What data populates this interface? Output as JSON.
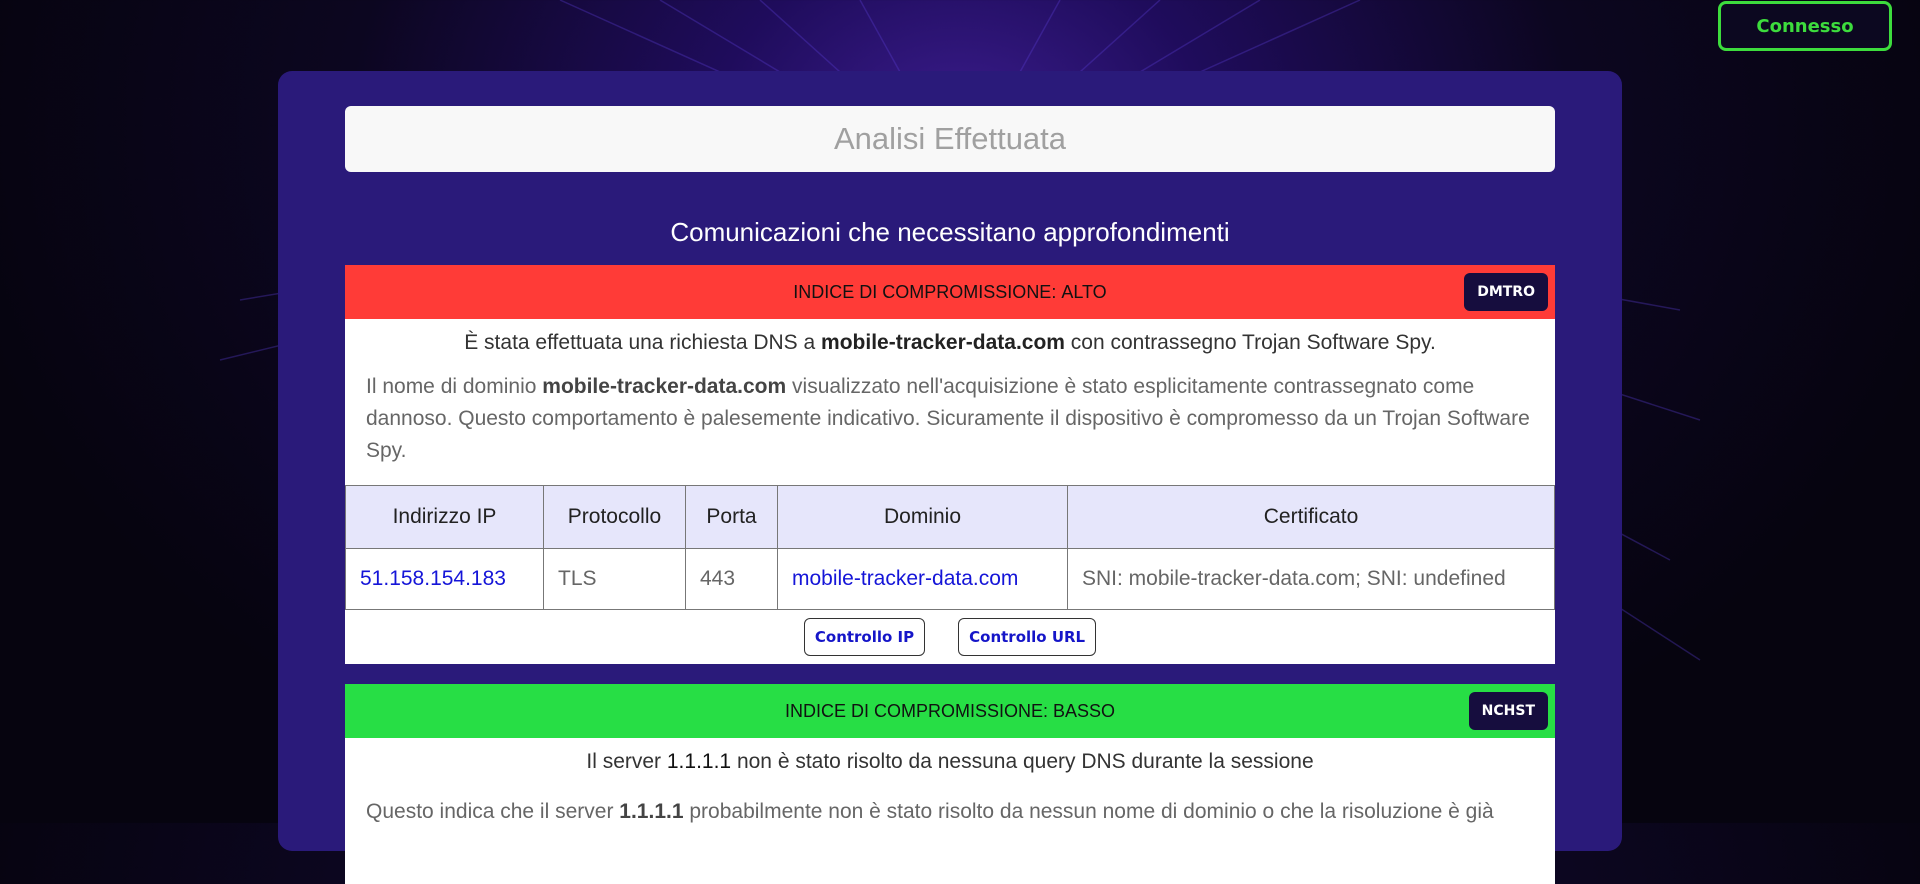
{
  "status_button": {
    "label": "Connesso",
    "color": "#3ddc3d"
  },
  "header": {
    "title": "Analisi Effettuata"
  },
  "section": {
    "title": "Comunicazioni che necessitano approfondimenti"
  },
  "cards": [
    {
      "index_label": "INDICE DI COMPROMISSIONE:",
      "level": "ALTO",
      "level_color": "#ff3b37",
      "badge": "DMTRO",
      "summary": {
        "pre": "È stata effettuata una richiesta DNS a ",
        "domain": "mobile-tracker-data.com",
        "post": " con contrassegno Trojan Software Spy."
      },
      "description": {
        "pre": "Il nome di dominio ",
        "domain": "mobile-tracker-data.com",
        "post": " visualizzato nell'acquisizione è stato esplicitamente contrassegnato come dannoso. Questo comportamento è palesemente indicativo. Sicuramente il dispositivo è compromesso da un Trojan Software Spy."
      },
      "table": {
        "headers": [
          "Indirizzo IP",
          "Protocollo",
          "Porta",
          "Dominio",
          "Certificato"
        ],
        "row": {
          "ip": "51.158.154.183",
          "protocol": "TLS",
          "port": "443",
          "domain": "mobile-tracker-data.com",
          "certificate": "SNI: mobile-tracker-data.com; SNI: undefined"
        }
      },
      "buttons": {
        "ip_check": "Controllo IP",
        "url_check": "Controllo URL"
      }
    },
    {
      "index_label": "INDICE DI COMPROMISSIONE:",
      "level": "BASSO",
      "level_color": "#27de45",
      "badge": "NCHST",
      "summary": {
        "pre": "Il server ",
        "ip": "1.1.1.1",
        "post": " non è stato risolto da nessuna query DNS durante la sessione"
      },
      "description": {
        "pre": "Questo indica che il server ",
        "ip": "1.1.1.1",
        "post": " probabilmente non è stato risolto da nessun nome di dominio o che la risoluzione è già"
      }
    }
  ]
}
